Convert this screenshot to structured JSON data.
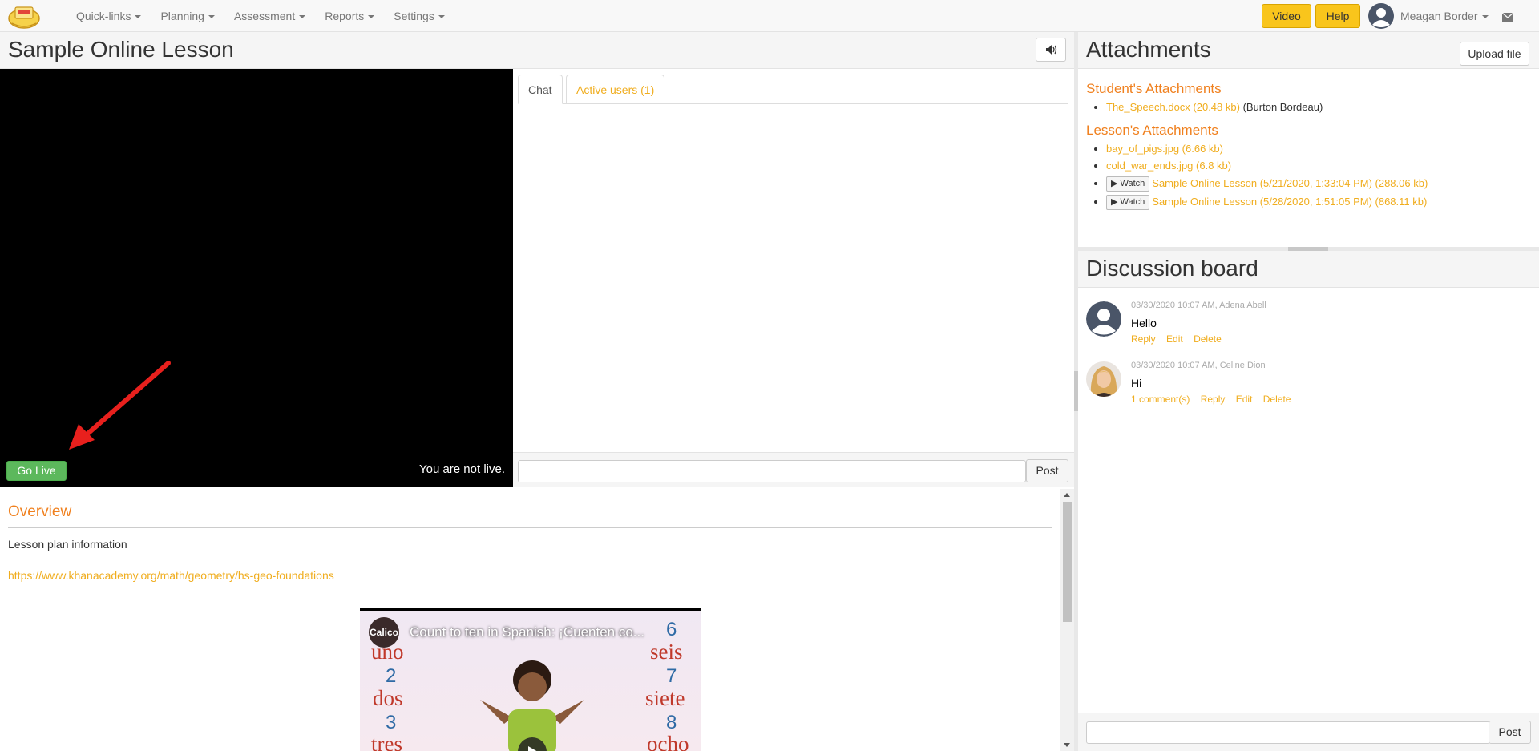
{
  "navbar": {
    "menu": [
      {
        "label": "Quick-links"
      },
      {
        "label": "Planning"
      },
      {
        "label": "Assessment"
      },
      {
        "label": "Reports"
      },
      {
        "label": "Settings"
      }
    ],
    "video_label": "Video",
    "help_label": "Help",
    "user_name": "Meagan Border",
    "icons": {
      "logo": "school-logo",
      "user": "user-avatar-icon",
      "mail": "envelope-icon"
    },
    "accent_color": "#f9c51c"
  },
  "lesson": {
    "title": "Sample Online Lesson",
    "go_live_label": "Go Live",
    "live_status": "You are not live."
  },
  "chat": {
    "tabs": [
      {
        "label": "Chat",
        "active": true
      },
      {
        "label": "Active users (1)",
        "active": false
      }
    ],
    "input_value": "",
    "post_label": "Post"
  },
  "overview": {
    "title": "Overview",
    "text": "Lesson plan information",
    "link": "https://www.khanacademy.org/math/geometry/hs-geo-foundations",
    "video": {
      "channel_logo": "Calico",
      "title": "Count to ten in Spanish: ¡Cuenten co...",
      "left_numbers": [
        "2",
        "3"
      ],
      "left_words": [
        "uno",
        "dos",
        "tres"
      ],
      "right_numbers": [
        "6",
        "7",
        "8"
      ],
      "right_words": [
        "seis",
        "siete",
        "ocho"
      ]
    }
  },
  "attachments": {
    "title": "Attachments",
    "upload_label": "Upload file",
    "student_heading": "Student's Attachments",
    "student_items": [
      {
        "name": "The_Speech.docx (20.48 kb)",
        "owner": "(Burton Bordeau)"
      }
    ],
    "lesson_heading": "Lesson's Attachments",
    "lesson_items": [
      {
        "name": "bay_of_pigs.jpg (6.66 kb)"
      },
      {
        "name": "cold_war_ends.jpg (6.8 kb)"
      }
    ],
    "recordings": [
      {
        "watch_label": "Watch",
        "name": "Sample Online Lesson (5/21/2020, 1:33:04 PM) (288.06 kb)"
      },
      {
        "watch_label": "Watch",
        "name": "Sample Online Lesson (5/28/2020, 1:51:05 PM) (868.11 kb)"
      }
    ]
  },
  "discussion": {
    "title": "Discussion board",
    "posts": [
      {
        "meta": "03/30/2020 10:07 AM, Adena Abell",
        "text": "Hello",
        "actions": [
          "Reply",
          "Edit",
          "Delete"
        ]
      },
      {
        "meta": "03/30/2020 10:07 AM, Celine Dion",
        "text": "Hi",
        "actions": [
          "1 comment(s)",
          "Reply",
          "Edit",
          "Delete"
        ]
      }
    ],
    "input_value": "",
    "post_label": "Post"
  }
}
